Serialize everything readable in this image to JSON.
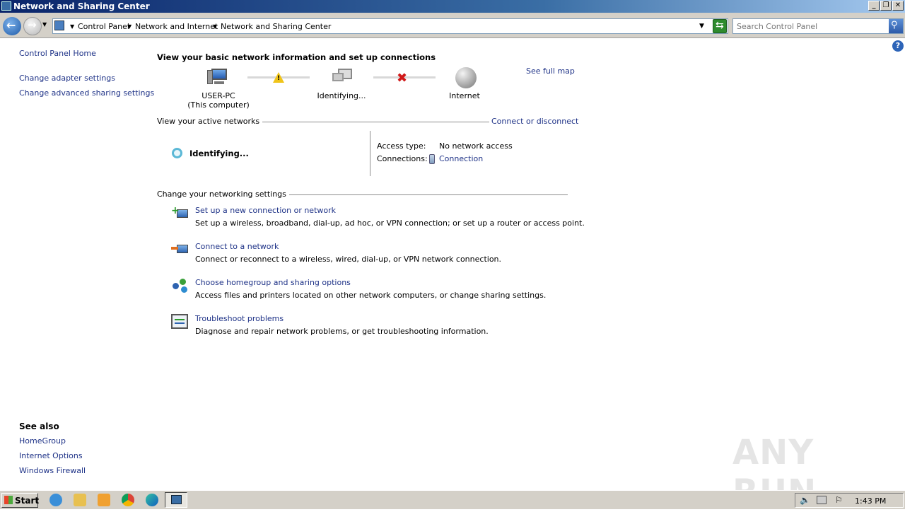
{
  "window": {
    "title": "Network and Sharing Center"
  },
  "address": {
    "crumbs": [
      "Control Panel",
      "Network and Internet",
      "Network and Sharing Center"
    ],
    "search_placeholder": "Search Control Panel"
  },
  "sidebar": {
    "home": "Control Panel Home",
    "links": [
      "Change adapter settings",
      "Change advanced sharing settings"
    ],
    "see_also_title": "See also",
    "see_also": [
      "HomeGroup",
      "Internet Options",
      "Windows Firewall"
    ]
  },
  "main": {
    "heading": "View your basic network information and set up connections",
    "see_full_map": "See full map",
    "map": {
      "computer_name": "USER-PC",
      "computer_sub": "(This computer)",
      "middle_label": "Identifying...",
      "internet_label": "Internet"
    },
    "active_networks_title": "View your active networks",
    "connect_link": "Connect or disconnect",
    "network_name": "Identifying...",
    "access_type_label": "Access type:",
    "access_type_value": "No network access",
    "connections_label": "Connections:",
    "connections_value": "Connection",
    "settings_title": "Change your networking settings",
    "tasks": [
      {
        "title": "Set up a new connection or network",
        "desc": "Set up a wireless, broadband, dial-up, ad hoc, or VPN connection; or set up a router or access point.",
        "icon": "new-connection-icon"
      },
      {
        "title": "Connect to a network",
        "desc": "Connect or reconnect to a wireless, wired, dial-up, or VPN network connection.",
        "icon": "connect-network-icon"
      },
      {
        "title": "Choose homegroup and sharing options",
        "desc": "Access files and printers located on other network computers, or change sharing settings.",
        "icon": "homegroup-icon"
      },
      {
        "title": "Troubleshoot problems",
        "desc": "Diagnose and repair network problems, or get troubleshooting information.",
        "icon": "troubleshoot-icon"
      }
    ]
  },
  "taskbar": {
    "start_label": "Start",
    "clock": "1:43 PM"
  },
  "watermark": "ANY RUN"
}
